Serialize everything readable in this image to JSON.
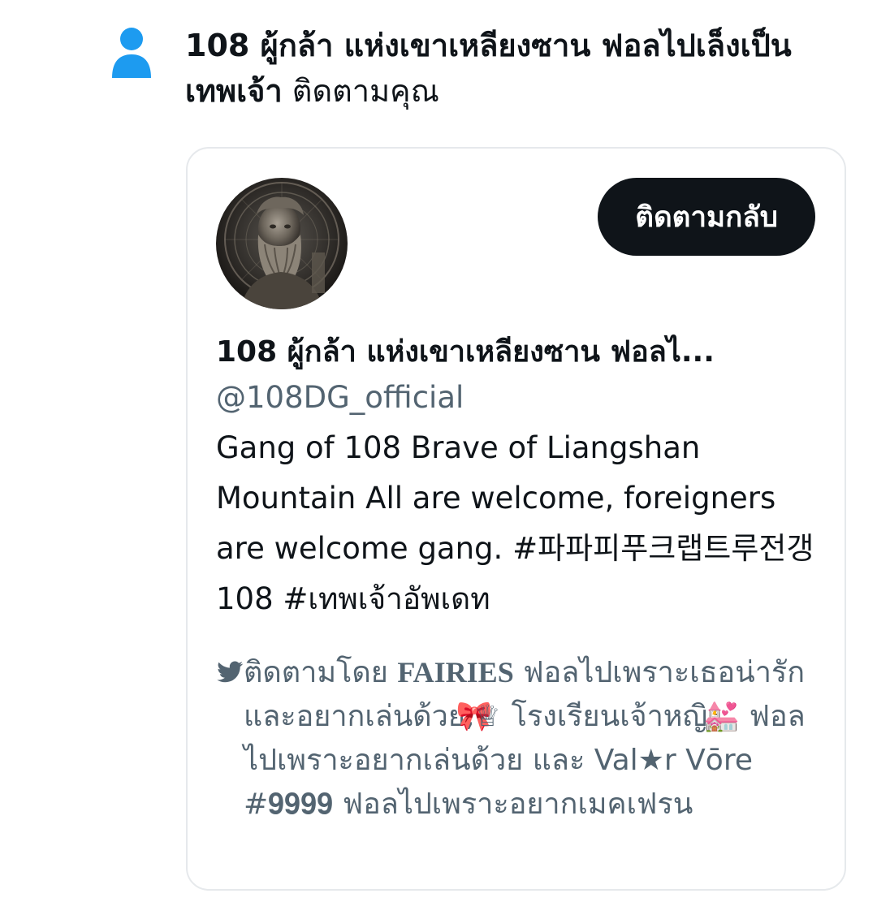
{
  "notification": {
    "actor_name_line": "108 ผู้กล้า แห่งเขาเหลียงซาน ฟอลไปเล็งเป็นเทพเจ้า",
    "action_text": " ติดตามคุณ"
  },
  "card": {
    "follow_back_label": "ติดตามกลับ",
    "display_name": "108 ผู้กล้า แห่งเขาเหลียงซาน ฟอลไ...",
    "handle": "@108DG_official",
    "bio": "Gang of 108 Brave of Liangshan Mountain  All are welcome, foreigners are welcome gang. #파파피푸크랩트루전갱108 #เทพเจ้าอัพเดท",
    "followed_by": {
      "prefix": "ติดตามโดย ",
      "name_1": "FAIRIES",
      "text_1": " ฟอลไปเพราะเธอน่ารักและอยากเล่นด้วย, ",
      "text_2": " โรงเรียนเจ้าหญิง ",
      "text_3": " ฟอลไปเพราะอยากเล่นด้วย และ Val★r Vōre #𝟗𝟗𝟗𝟗 ฟอลไปเพราะอยากเมคเฟรน"
    }
  },
  "icons": {
    "person": "person-icon",
    "bird": "bird-icon",
    "ribbon": "ribbon-icon",
    "crown": "crown-icon",
    "church": "wedding-church-icon"
  },
  "colors": {
    "accent": "#1d9bf0",
    "text": "#0f1419",
    "secondary": "#536471",
    "border": "#e6e9ec",
    "button": "#0f1419"
  }
}
